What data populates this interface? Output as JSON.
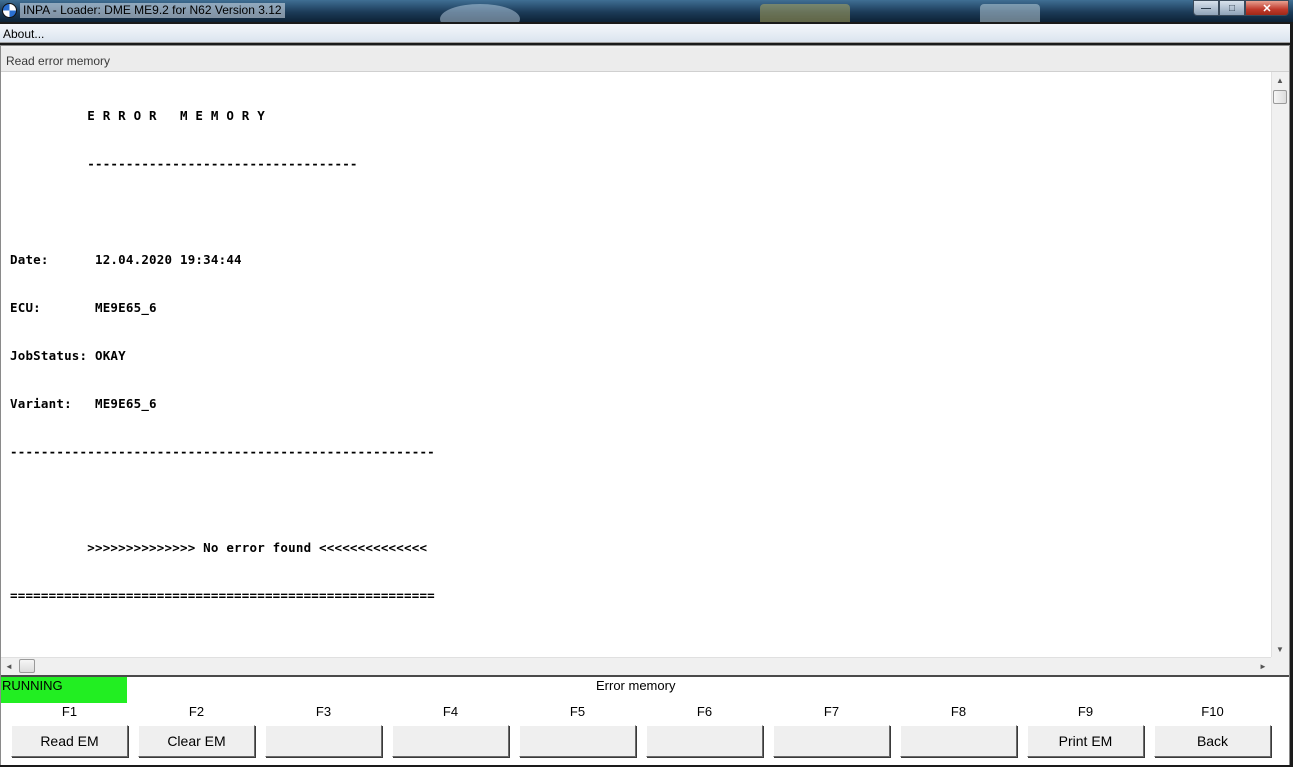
{
  "window": {
    "title": "INPA - Loader:  DME ME9.2 for N62 Version 3.12",
    "icon": "bmw-logo-icon",
    "controls": {
      "minimize": "—",
      "maximize": "□",
      "close": "✕"
    }
  },
  "menu": {
    "items": [
      {
        "label": "About..."
      }
    ]
  },
  "panel": {
    "title": "Read error memory",
    "lines": [
      "          E R R O R   M E M O R Y",
      "          -----------------------------------",
      "",
      "Date:      12.04.2020 19:34:44",
      "ECU:       ME9E65_6",
      "JobStatus: OKAY",
      "Variant:   ME9E65_6",
      "-------------------------------------------------------",
      "",
      "          >>>>>>>>>>>>>> No error found <<<<<<<<<<<<<<",
      "======================================================="
    ]
  },
  "scrollbars": {
    "up": "▲",
    "down": "▼",
    "left": "◄",
    "right": "►"
  },
  "status": {
    "state": "RUNNING",
    "state_color": "#22ee22",
    "message": "Error memory"
  },
  "fkeys": [
    {
      "key": "F1",
      "label": "Read EM"
    },
    {
      "key": "F2",
      "label": "Clear EM"
    },
    {
      "key": "F3",
      "label": ""
    },
    {
      "key": "F4",
      "label": ""
    },
    {
      "key": "F5",
      "label": ""
    },
    {
      "key": "F6",
      "label": ""
    },
    {
      "key": "F7",
      "label": ""
    },
    {
      "key": "F8",
      "label": ""
    },
    {
      "key": "F9",
      "label": "Print EM"
    },
    {
      "key": "F10",
      "label": "Back"
    }
  ]
}
